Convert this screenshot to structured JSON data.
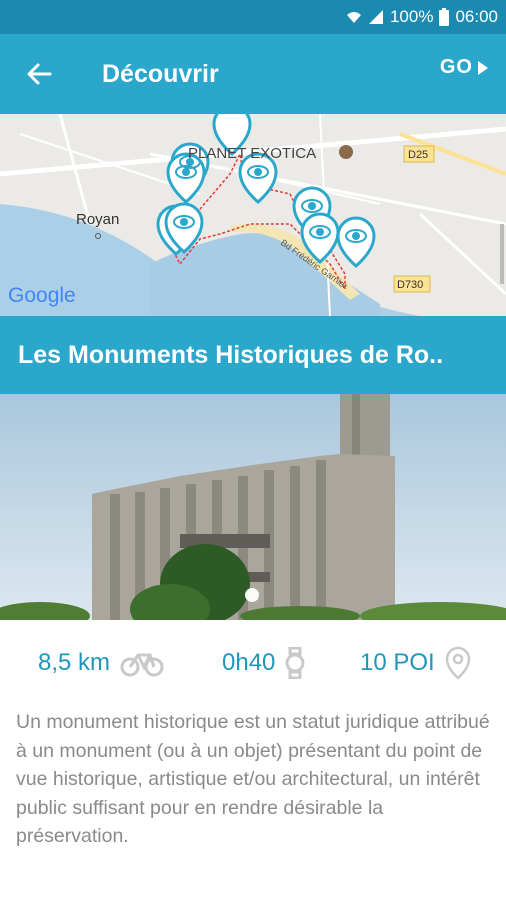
{
  "status": {
    "battery": "100%",
    "time": "06:00"
  },
  "appbar": {
    "title": "Découvrir",
    "go_label": "GO"
  },
  "map": {
    "label_planet": "PLANET EXOTICA",
    "label_royan": "Royan",
    "road_d25": "D25",
    "road_d730": "D730",
    "street": "Bd Frédéric Garnier",
    "google": "Google"
  },
  "banner": {
    "title": "Les Monuments Historiques de Ro.."
  },
  "stats": {
    "distance": "8,5 km",
    "duration": "0h40",
    "poi": "10 POI"
  },
  "description": "Un monument historique est un statut juridique attribué à un monument (ou à un objet) présentant du point de vue historique, artistique et/ou architectural, un intérêt public suffisant pour en rendre désirable la préservation.",
  "colors": {
    "primary": "#2aa7cb",
    "status_bar": "#1b8ab0",
    "accent_text": "#2196bd"
  }
}
